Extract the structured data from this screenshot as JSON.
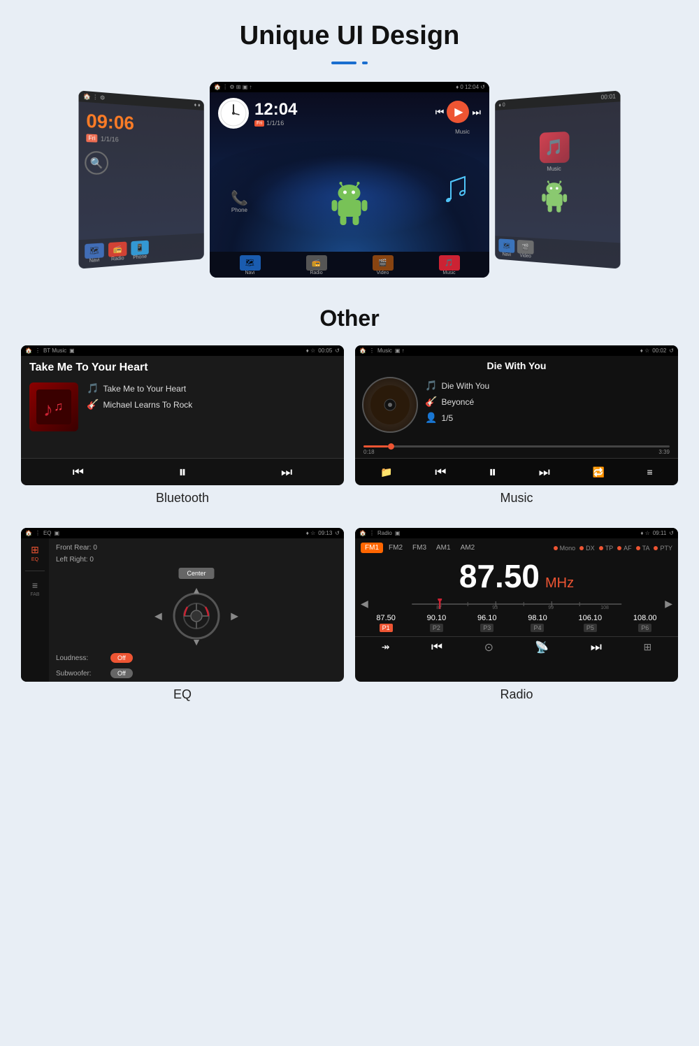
{
  "page": {
    "bg_color": "#e8eef5"
  },
  "header": {
    "title": "Unique UI Design",
    "subtitle": "Other"
  },
  "triptych": {
    "left": {
      "time": "09:06",
      "date_badge": "Fri",
      "date": "1/1/16"
    },
    "center": {
      "time": "12:04",
      "date_badge": "Fri",
      "date": "1/1/16",
      "nav_items": [
        "Phone",
        "Navi",
        "Radio",
        "Video",
        "Music"
      ]
    },
    "right": {
      "time": "00:01",
      "nav_items": [
        "Navi",
        "Video"
      ]
    }
  },
  "bluetooth_screen": {
    "status_left": "BT Music",
    "status_right": "00:05",
    "title": "Take Me To Your Heart",
    "track_name": "Take Me to Your Heart",
    "artist": "Michael Learns To Rock"
  },
  "music_screen": {
    "status_left": "Music",
    "status_right": "00:02",
    "title": "Die With You",
    "track_name": "Die With You",
    "artist": "Beyoncé",
    "track_num": "1/5",
    "time_current": "0:18",
    "time_total": "3:39"
  },
  "eq_screen": {
    "status_left": "EQ",
    "status_right": "09:13",
    "front_rear": "Front Rear: 0",
    "left_right": "Left Right: 0",
    "loudness": "Loudness:",
    "loudness_state": "Off",
    "subwoofer": "Subwoofer:",
    "subwoofer_state": "Off",
    "center_btn": "Center",
    "sidebar_items": [
      {
        "icon": "⊞",
        "label": "EQ",
        "active": true
      },
      {
        "icon": "≡",
        "label": "FAB",
        "active": false
      }
    ]
  },
  "radio_screen": {
    "status_left": "Radio",
    "status_right": "09:11",
    "tabs": [
      "FM1",
      "FM2",
      "FM3",
      "AM1",
      "AM2"
    ],
    "active_tab": "FM1",
    "options": [
      "Mono",
      "DX",
      "TP",
      "AF",
      "TA",
      "PTY"
    ],
    "frequency": "87.50",
    "unit": "MHz",
    "presets": [
      {
        "freq": "87.50",
        "label": "P1",
        "active": true
      },
      {
        "freq": "90.10",
        "label": "P2",
        "active": false
      },
      {
        "freq": "96.10",
        "label": "P3",
        "active": false
      },
      {
        "freq": "98.10",
        "label": "P4",
        "active": false
      },
      {
        "freq": "106.10",
        "label": "P5",
        "active": false
      },
      {
        "freq": "108.00",
        "label": "P6",
        "active": false
      }
    ]
  },
  "labels": {
    "bluetooth": "Bluetooth",
    "music": "Music",
    "eq": "EQ",
    "radio": "Radio"
  },
  "icons": {
    "prev": "⏮",
    "play": "▶",
    "pause": "⏸",
    "next": "⏭",
    "skip_back": "|◀",
    "skip_fwd": "▶|",
    "repeat": "🔁",
    "eq_icon": "⊞",
    "folder": "📁",
    "list": "≡",
    "arrow_left": "◀",
    "arrow_right": "▶",
    "arrow_up": "▲",
    "arrow_down": "▼"
  }
}
